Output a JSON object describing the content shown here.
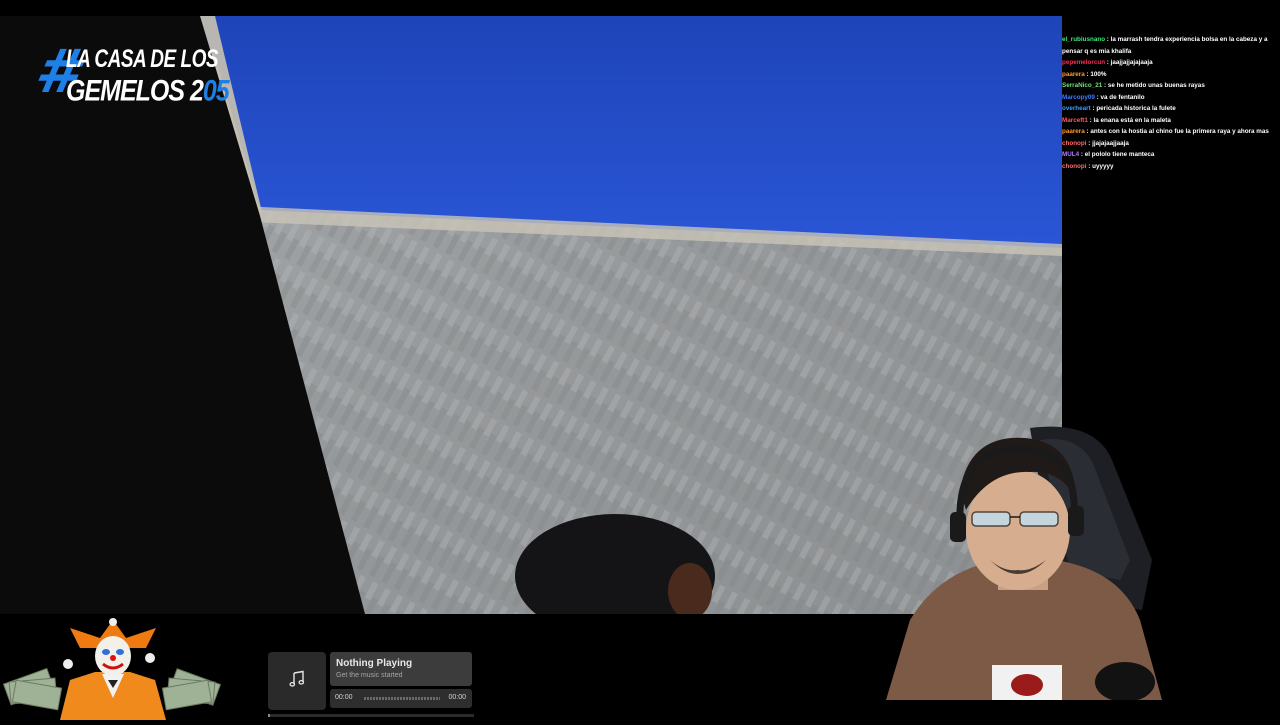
{
  "stream": {
    "logo": {
      "hash": "#",
      "line1": "LA CASA DE LOS",
      "line2_main": "GEMELOS 2",
      "line2_accent": "05"
    }
  },
  "chat": {
    "messages": [
      {
        "user": "el_rubiusnano",
        "color": "#3be87a",
        "text": "la marrash tendra experiencia bolsa en la cabeza y a pensar q es mia khalifa"
      },
      {
        "user": "pepemelorcun",
        "color": "#ff2d55",
        "text": "jaajjajjajajaaja"
      },
      {
        "user": "paarera",
        "color": "#ff9a2e",
        "text": "100%"
      },
      {
        "user": "SerraNico_21",
        "color": "#6ee37a",
        "text": "se he metido unas buenas rayas"
      },
      {
        "user": "Marcopy09",
        "color": "#3d7dff",
        "text": "va de fentanilo"
      },
      {
        "user": "overheart",
        "color": "#3d9bff",
        "text": "pericada historica la fulete"
      },
      {
        "user": "Marceft1",
        "color": "#ff5a5a",
        "text": "la enana está en la maleta"
      },
      {
        "user": "paarera",
        "color": "#ff9a2e",
        "text": "antes con la hostia al chino fue la primera raya y ahora mas"
      },
      {
        "user": "chonopi",
        "color": "#ff6b6b",
        "text": "jjajajaajjaaja"
      },
      {
        "user": "MUL4",
        "color": "#b07cff",
        "text": "el pololo tiene manteca"
      },
      {
        "user": "chonopi",
        "color": "#ff6b6b",
        "text": "uyyyyy"
      }
    ]
  },
  "music_widget": {
    "title": "Nothing Playing",
    "subtitle": "Get the music started",
    "time_current": "00:00",
    "time_total": "00:00",
    "icon": "music-note-icon",
    "progress": 0
  }
}
